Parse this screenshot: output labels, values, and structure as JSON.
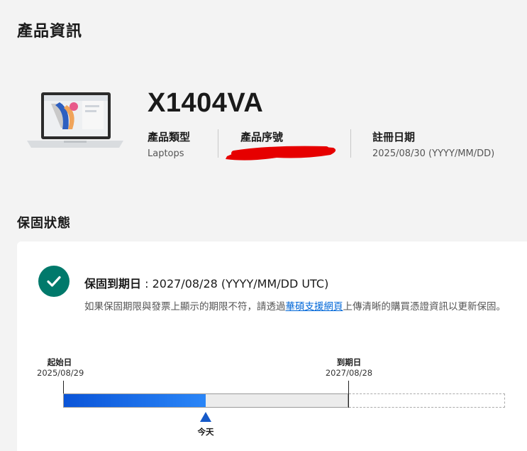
{
  "page": {
    "title": "產品資訊"
  },
  "product": {
    "model": "X1404VA",
    "image": "laptop-image",
    "type_label": "產品類型",
    "type_value": "Laptops",
    "serial_label": "產品序號",
    "date_label": "註冊日期",
    "date_value": "2025/08/30 (YYYY/MM/DD)"
  },
  "warranty": {
    "section_title": "保固狀態",
    "status_icon": "check-circle-icon",
    "expiry_label": "保固到期日",
    "expiry_value": ": 2027/08/28 (YYYY/MM/DD UTC)",
    "note_before": "如果保固期限與發票上顯示的期限不符，請透過",
    "note_link": "華碩支援網頁",
    "note_after": "上傳清晰的購買憑證資訊以更新保固。",
    "timeline": {
      "start_label": "起始日",
      "start_date": "2025/08/29",
      "end_label": "到期日",
      "end_date": "2027/08/28",
      "today_label": "今天",
      "elapsed_fraction": 0.5
    }
  },
  "colors": {
    "accent_teal": "#00796b",
    "progress_blue": "#0a54d8",
    "link": "#0067d8",
    "redaction": "#e00000"
  }
}
